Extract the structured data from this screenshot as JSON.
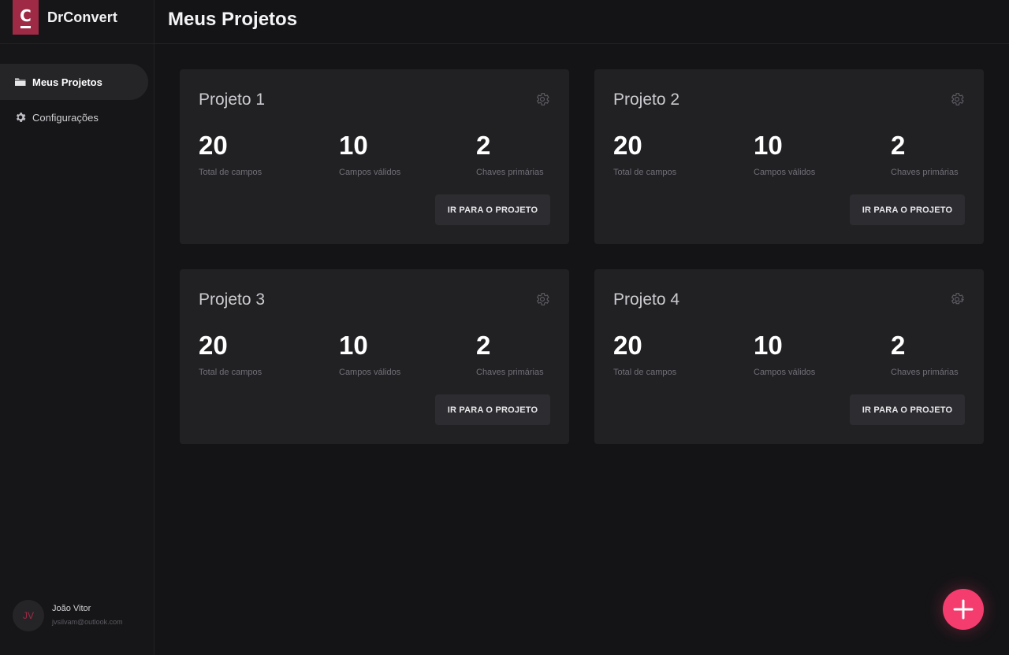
{
  "app": {
    "name": "DrConvert",
    "logo_letter": "C",
    "accent": "#9e2a45"
  },
  "sidebar": {
    "items": [
      {
        "label": "Meus Projetos",
        "icon": "folder-icon",
        "active": true
      },
      {
        "label": "Configurações",
        "icon": "gear-icon",
        "active": false
      }
    ]
  },
  "user": {
    "initials": "JV",
    "name": "João Vitor",
    "email": "jvsilvam@outlook.com"
  },
  "header": {
    "title": "Meus Projetos"
  },
  "projects": [
    {
      "title": "Projeto 1",
      "stats": [
        {
          "value": "20",
          "label": "Total de campos"
        },
        {
          "value": "10",
          "label": "Campos válidos"
        },
        {
          "value": "2",
          "label": "Chaves primárias"
        }
      ],
      "button": "IR PARA O PROJETO"
    },
    {
      "title": "Projeto 2",
      "stats": [
        {
          "value": "20",
          "label": "Total de campos"
        },
        {
          "value": "10",
          "label": "Campos válidos"
        },
        {
          "value": "2",
          "label": "Chaves primárias"
        }
      ],
      "button": "IR PARA O PROJETO"
    },
    {
      "title": "Projeto 3",
      "stats": [
        {
          "value": "20",
          "label": "Total de campos"
        },
        {
          "value": "10",
          "label": "Campos válidos"
        },
        {
          "value": "2",
          "label": "Chaves primárias"
        }
      ],
      "button": "IR PARA O PROJETO"
    },
    {
      "title": "Projeto 4",
      "stats": [
        {
          "value": "20",
          "label": "Total de campos"
        },
        {
          "value": "10",
          "label": "Campos válidos"
        },
        {
          "value": "2",
          "label": "Chaves primárias"
        }
      ],
      "button": "IR PARA O PROJETO"
    }
  ],
  "fab": {
    "icon": "plus-icon",
    "color": "#f43d6e"
  }
}
